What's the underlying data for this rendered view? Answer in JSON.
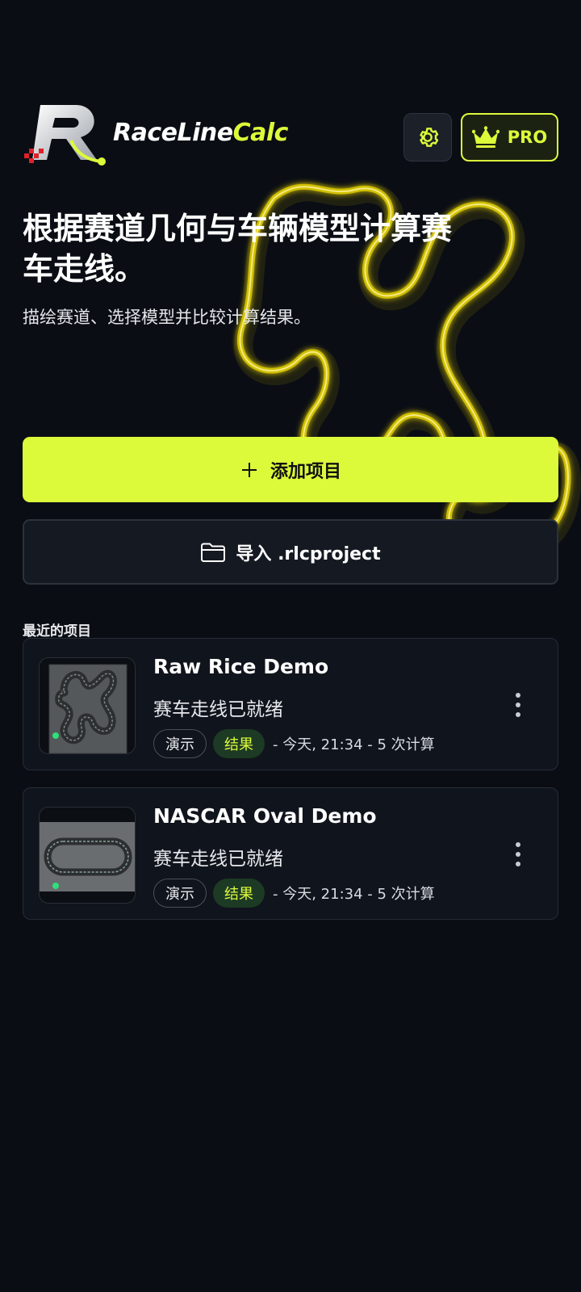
{
  "app": {
    "logo_text_main": "RaceLine",
    "logo_text_accent": "Calc",
    "logo_mark": "R"
  },
  "header": {
    "settings_icon": "gear-icon",
    "pro_icon": "crown-icon",
    "pro_label": "PRO"
  },
  "hero": {
    "title": "根据赛道几何与车辆模型计算赛车走线。",
    "subtitle": "描绘赛道、选择模型并比较计算结果。"
  },
  "actions": {
    "add_icon": "plus-icon",
    "add_label": "添加项目",
    "import_icon": "folder-icon",
    "import_label": "导入 .rlcproject"
  },
  "recent": {
    "label": "最近的项目",
    "projects": [
      {
        "title": "Raw Rice Demo",
        "status": "赛车走线已就绪",
        "badge_demo": "演示",
        "badge_result": "结果",
        "meta": "- 今天, 21:34 - 5 次计算",
        "thumbnail": "winding-track"
      },
      {
        "title": "NASCAR Oval Demo",
        "status": "赛车走线已就绪",
        "badge_demo": "演示",
        "badge_result": "结果",
        "meta": "- 今天, 21:34 - 5 次计算",
        "thumbnail": "oval-track"
      }
    ]
  },
  "colors": {
    "background": "#0a0d14",
    "accent": "#dcfa3a",
    "card": "#10141c",
    "result_badge": "#1d3a24"
  }
}
